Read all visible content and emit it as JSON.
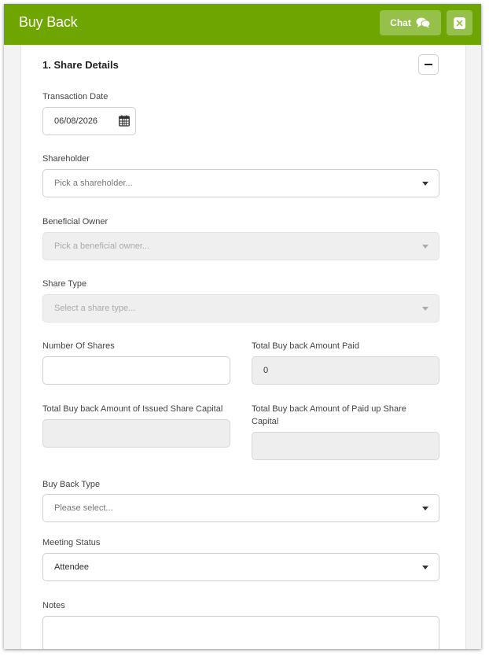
{
  "header": {
    "title": "Buy Back",
    "chat_label": "Chat"
  },
  "section": {
    "title": "1. Share Details"
  },
  "form": {
    "transaction_date": {
      "label": "Transaction Date",
      "value": "06/08/2026"
    },
    "shareholder": {
      "label": "Shareholder",
      "placeholder": "Pick a shareholder..."
    },
    "beneficial_owner": {
      "label": "Beneficial Owner",
      "placeholder": "Pick a beneficial owner..."
    },
    "share_type": {
      "label": "Share Type",
      "placeholder": "Select a share type..."
    },
    "number_of_shares": {
      "label": "Number Of Shares",
      "value": ""
    },
    "total_amount_paid": {
      "label": "Total Buy back Amount Paid",
      "value": "0"
    },
    "issued_share_capital": {
      "label": "Total Buy back Amount of Issued Share Capital",
      "value": ""
    },
    "paid_up_share_capital": {
      "label": "Total Buy back Amount of Paid up Share Capital",
      "value": ""
    },
    "buy_back_type": {
      "label": "Buy Back Type",
      "placeholder": "Please select..."
    },
    "meeting_status": {
      "label": "Meeting Status",
      "value": "Attendee"
    },
    "notes": {
      "label": "Notes",
      "value": ""
    }
  },
  "colors": {
    "header_bg": "#6ea500",
    "header_button_bg": "#95c14a",
    "disabled_field_bg": "#efefef"
  },
  "icons": {
    "chat": "chat-bubbles-icon",
    "close": "close-icon",
    "collapse": "minus-icon",
    "calendar": "calendar-icon",
    "dropdown": "caret-down-icon"
  }
}
